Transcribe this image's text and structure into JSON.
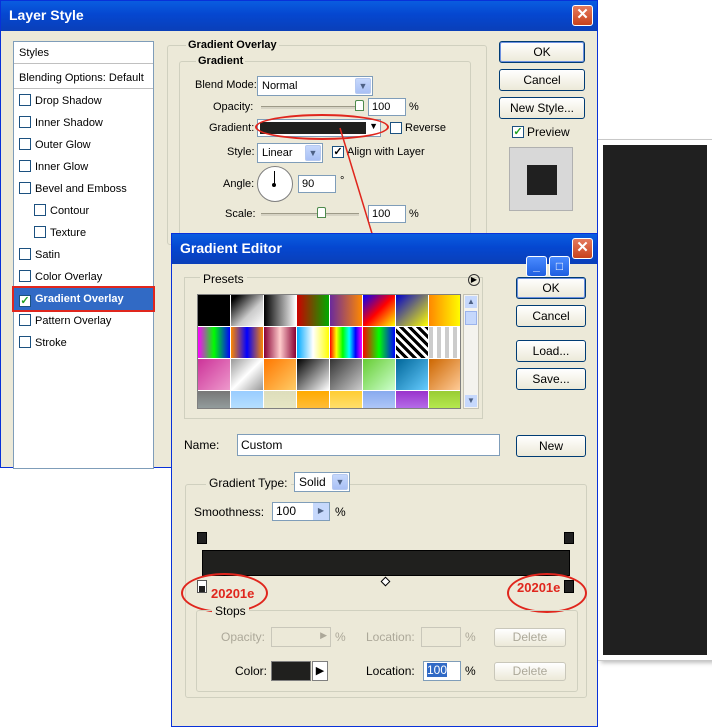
{
  "layer_style": {
    "title": "Layer Style",
    "styles_list": [
      {
        "label": "Styles",
        "type": "header"
      },
      {
        "label": "Blending Options: Default",
        "type": "header"
      },
      {
        "label": "Drop Shadow",
        "checked": false
      },
      {
        "label": "Inner Shadow",
        "checked": false
      },
      {
        "label": "Outer Glow",
        "checked": false
      },
      {
        "label": "Inner Glow",
        "checked": false
      },
      {
        "label": "Bevel and Emboss",
        "checked": false
      },
      {
        "label": "Contour",
        "checked": false,
        "indent": true
      },
      {
        "label": "Texture",
        "checked": false,
        "indent": true
      },
      {
        "label": "Satin",
        "checked": false
      },
      {
        "label": "Color Overlay",
        "checked": false
      },
      {
        "label": "Gradient Overlay",
        "checked": true,
        "selected": true
      },
      {
        "label": "Pattern Overlay",
        "checked": false
      },
      {
        "label": "Stroke",
        "checked": false
      }
    ],
    "section_title": "Gradient Overlay",
    "group_title": "Gradient",
    "blend_mode_label": "Blend Mode:",
    "blend_mode_value": "Normal",
    "opacity_label": "Opacity:",
    "opacity_value": "100",
    "opacity_percent": 100,
    "percent_sign": "%",
    "gradient_label": "Gradient:",
    "reverse_label": "Reverse",
    "style_label": "Style:",
    "style_value": "Linear",
    "align_label": "Align with Layer",
    "angle_label": "Angle:",
    "angle_value": "90",
    "degree_sign": "°",
    "scale_label": "Scale:",
    "scale_value": "100",
    "scale_percent": 100,
    "ok_label": "OK",
    "cancel_label": "Cancel",
    "new_style_label": "New Style...",
    "preview_label": "Preview",
    "preview_checked": true
  },
  "gradient_editor": {
    "title": "Gradient Editor",
    "presets_label": "Presets",
    "ok_label": "OK",
    "cancel_label": "Cancel",
    "load_label": "Load...",
    "save_label": "Save...",
    "name_label": "Name:",
    "name_value": "Custom",
    "new_label": "New",
    "gradient_type_label": "Gradient Type:",
    "gradient_type_value": "Solid",
    "smoothness_label": "Smoothness:",
    "smoothness_value": "100",
    "percent_sign": "%",
    "left_stop_annotation": "20201e",
    "right_stop_annotation": "20201e",
    "stops_label": "Stops",
    "stop_opacity_label": "Opacity:",
    "stop_location_label": "Location:",
    "delete_label": "Delete",
    "color_label": "Color:",
    "color_location_label": "Location:",
    "color_location_value": "100",
    "gradient_color": "#20201e"
  },
  "colors": {
    "xp_blue": "#0a5de0",
    "selection": "#316ac5",
    "annotation_red": "#e0261d",
    "canvas_dark": "#202020"
  }
}
